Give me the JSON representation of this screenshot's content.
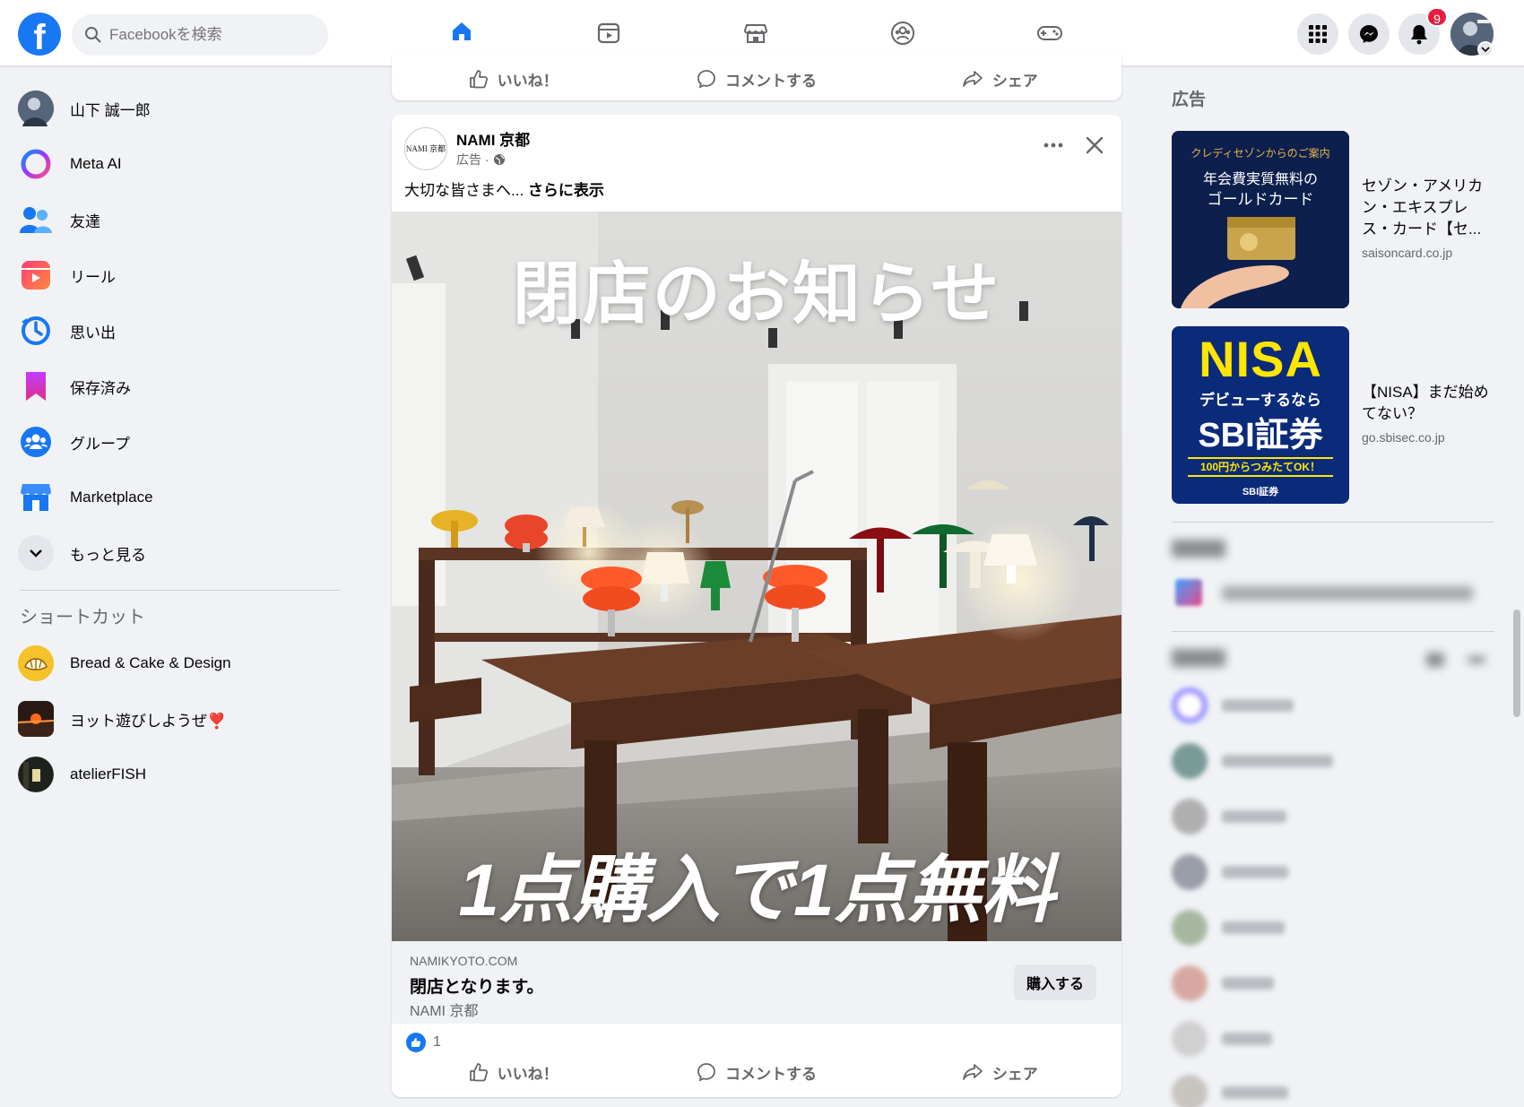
{
  "topbar": {
    "logo": "f",
    "search_placeholder": "Facebookを検索",
    "notification_count": "9"
  },
  "left_nav": {
    "items": [
      {
        "label": "山下 誠一郎",
        "icon": "profile-avatar"
      },
      {
        "label": "Meta AI",
        "icon": "meta-ai-icon"
      },
      {
        "label": "友達",
        "icon": "friends-icon"
      },
      {
        "label": "リール",
        "icon": "reels-icon"
      },
      {
        "label": "思い出",
        "icon": "memories-icon"
      },
      {
        "label": "保存済み",
        "icon": "saved-icon"
      },
      {
        "label": "グループ",
        "icon": "groups-icon"
      },
      {
        "label": "Marketplace",
        "icon": "marketplace-icon"
      },
      {
        "label": "もっと見る",
        "icon": "chevron-down-icon"
      }
    ],
    "shortcuts_title": "ショートカット",
    "shortcuts": [
      {
        "label": "Bread & Cake & Design"
      },
      {
        "label": "ヨット遊びしようぜ❣️"
      },
      {
        "label": "atelierFISH"
      }
    ]
  },
  "post_actions": {
    "like": "いいね！",
    "comment": "コメントする",
    "share": "シェア"
  },
  "post": {
    "page_name": "NAMI 京都",
    "avatar_text": "NAMI 京都",
    "sponsored": "広告 ·",
    "text": "大切な皆さまへ...",
    "see_more": "さらに表示",
    "image_headline": "閉店のお知らせ",
    "image_offer": "1点購入で1点無料",
    "link_domain": "NAMIKYOTO.COM",
    "link_title": "閉店となります。",
    "link_subtitle": "NAMI 京都",
    "cta": "購入する",
    "reaction_count": "1"
  },
  "right_col": {
    "ads_title": "広告",
    "ads": [
      {
        "title": "セゾン・アメリカン・エキスプレス・カード【セ...",
        "domain": "saisoncard.co.jp",
        "image_line1": "クレディセゾンからのご案内",
        "image_line2": "年会費実質無料",
        "image_line3": "の",
        "image_line4": "ゴールドカード"
      },
      {
        "title": "【NISA】まだ始めてない？",
        "domain": "go.sbisec.co.jp",
        "image_line1": "NISA",
        "image_line2": "デビューするなら",
        "image_line3": "SBI証券",
        "image_line4": "100円からつみたてOK！",
        "image_line5": "SBI証券"
      }
    ]
  },
  "colors": {
    "brand": "#1877f2",
    "badge": "#e41e3f",
    "background": "#f0f2f5"
  }
}
